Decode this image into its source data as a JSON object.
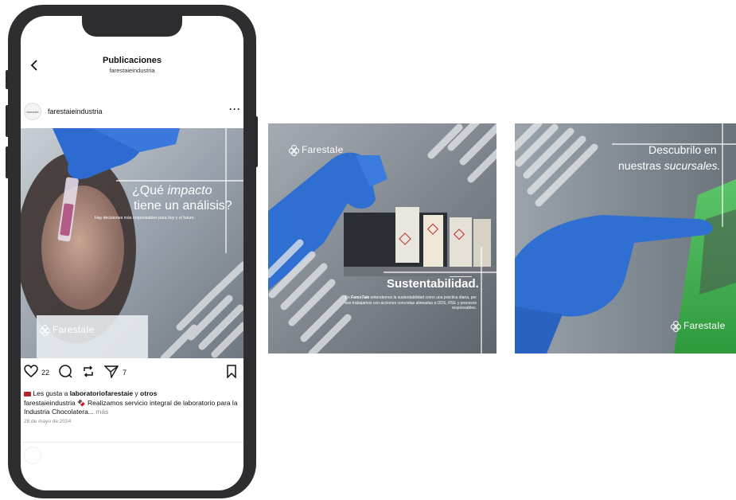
{
  "header": {
    "back_icon": "chevron-left-icon",
    "title": "Publicaciones",
    "subtitle": "farestaieindustria"
  },
  "post": {
    "username": "farestaieindustria",
    "avatar_text": "farestaie",
    "more_icon": "more-horizontal-icon",
    "image": {
      "question_prefix": "¿Qué ",
      "question_emph": "impacto",
      "question_line2": "tiene un análisis?",
      "small_text": "Hay decisiones más responsables para hoy y el futuro.",
      "logo": "FarestaIe"
    },
    "actions": {
      "like_count": "22",
      "share_count": "7"
    },
    "likes_prefix": "Les gusta a ",
    "likes_user": "laboratoriofarestaie",
    "likes_and": " y ",
    "likes_others": "otros",
    "caption_user": "farestaieindustria",
    "caption_text": " 🍫 Realizamos servicio integral de laboratorio para la Industria Chocolatera...",
    "caption_more": " más",
    "date": "28 de mayo de 2024"
  },
  "tile2": {
    "logo": "FarestaIe",
    "heading": "Sustentabilidad.",
    "body_prefix": "En ",
    "body_brand": "FaresTaIe",
    "body_text": " entendemos la sustentabilidad como una práctica diaria, por eso trabajamos con acciones concretas alineadas a ODS, RSE y procesos responsables."
  },
  "tile3": {
    "line1": "Descubrilo en",
    "line2_prefix": "nuestras ",
    "line2_emph": "sucursales.",
    "logo": "FarestaIe"
  },
  "colors": {
    "phone_frame": "#2e2e30",
    "glove_blue": "#2e6bd0",
    "overlay_gray": "#8a8e94",
    "accent_green": "#39b34a"
  }
}
